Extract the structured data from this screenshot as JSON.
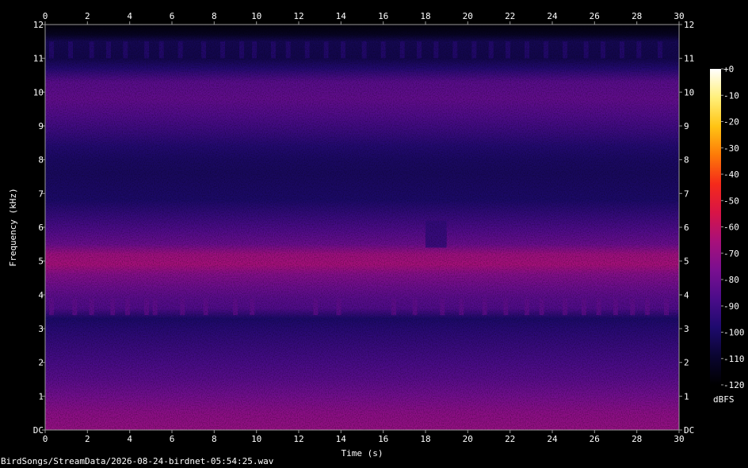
{
  "file": {
    "name": "BirdSongs/StreamData/2026-08-24-birdnet-05:54:25.wav"
  },
  "chart_data": {
    "type": "heatmap",
    "xlabel": "Time (s)",
    "ylabel": "Frequency (kHz)",
    "xlim": [
      0,
      30
    ],
    "ylim": [
      0,
      12
    ],
    "x_ticks": [
      0,
      2,
      4,
      6,
      8,
      10,
      12,
      14,
      16,
      18,
      20,
      22,
      24,
      26,
      28,
      30
    ],
    "y_ticks": [
      {
        "value": 0,
        "label": "DC"
      },
      {
        "value": 1,
        "label": "1"
      },
      {
        "value": 2,
        "label": "2"
      },
      {
        "value": 3,
        "label": "3"
      },
      {
        "value": 4,
        "label": "4"
      },
      {
        "value": 5,
        "label": "5"
      },
      {
        "value": 6,
        "label": "6"
      },
      {
        "value": 7,
        "label": "7"
      },
      {
        "value": 8,
        "label": "8"
      },
      {
        "value": 9,
        "label": "9"
      },
      {
        "value": 10,
        "label": "10"
      },
      {
        "value": 11,
        "label": "11"
      },
      {
        "value": 12,
        "label": "12"
      }
    ],
    "colorbar": {
      "label": "dBFS",
      "range": [
        -120,
        0
      ],
      "ticks": [
        {
          "value": 0,
          "label": "+0"
        },
        {
          "value": -10,
          "label": "-10"
        },
        {
          "value": -20,
          "label": "-20"
        },
        {
          "value": -30,
          "label": "-30"
        },
        {
          "value": -40,
          "label": "-40"
        },
        {
          "value": -50,
          "label": "-50"
        },
        {
          "value": -60,
          "label": "-60"
        },
        {
          "value": -70,
          "label": "-70"
        },
        {
          "value": -80,
          "label": "-80"
        },
        {
          "value": -90,
          "label": "-90"
        },
        {
          "value": -100,
          "label": "-100"
        },
        {
          "value": -110,
          "label": "-110"
        },
        {
          "value": -120,
          "label": "-120"
        }
      ],
      "colors": [
        "#000000",
        "#0a0530",
        "#1e0a6e",
        "#4b0c8a",
        "#7a0f90",
        "#a8107a",
        "#d81446",
        "#f52a1a",
        "#fd7a08",
        "#ffc414",
        "#fff07a",
        "#ffffff"
      ]
    },
    "frequency_profile_dbfs": [
      {
        "khz": 0.0,
        "db": -70
      },
      {
        "khz": 0.5,
        "db": -72
      },
      {
        "khz": 1.0,
        "db": -78
      },
      {
        "khz": 1.5,
        "db": -84
      },
      {
        "khz": 2.0,
        "db": -88
      },
      {
        "khz": 2.5,
        "db": -92
      },
      {
        "khz": 3.0,
        "db": -96
      },
      {
        "khz": 3.3,
        "db": -99
      },
      {
        "khz": 3.6,
        "db": -86
      },
      {
        "khz": 3.9,
        "db": -84
      },
      {
        "khz": 4.2,
        "db": -80
      },
      {
        "khz": 4.6,
        "db": -74
      },
      {
        "khz": 4.9,
        "db": -66
      },
      {
        "khz": 5.2,
        "db": -68
      },
      {
        "khz": 5.5,
        "db": -80
      },
      {
        "khz": 5.9,
        "db": -86
      },
      {
        "khz": 6.3,
        "db": -92
      },
      {
        "khz": 6.8,
        "db": -99
      },
      {
        "khz": 7.2,
        "db": -100
      },
      {
        "khz": 7.6,
        "db": -101
      },
      {
        "khz": 8.0,
        "db": -100
      },
      {
        "khz": 8.4,
        "db": -97
      },
      {
        "khz": 8.8,
        "db": -92
      },
      {
        "khz": 9.3,
        "db": -86
      },
      {
        "khz": 9.8,
        "db": -82
      },
      {
        "khz": 10.3,
        "db": -84
      },
      {
        "khz": 10.7,
        "db": -97
      },
      {
        "khz": 11.0,
        "db": -104
      },
      {
        "khz": 11.5,
        "db": -103
      },
      {
        "khz": 11.7,
        "db": -112
      },
      {
        "khz": 12.0,
        "db": -118
      }
    ],
    "events": [
      {
        "label": "chirps ~3.6 kHz",
        "khz_low": 3.4,
        "khz_high": 3.9,
        "db": -82,
        "times_s": [
          0.3,
          1.4,
          2.2,
          3.2,
          3.9,
          4.8,
          5.2,
          6.5,
          7.6,
          9.0,
          9.8,
          12.8,
          13.9,
          16.5,
          17.5,
          18.8,
          19.7,
          20.8,
          21.8,
          22.8,
          23.5,
          24.6,
          25.5,
          26.2,
          27.0,
          27.8,
          28.5,
          29.4
        ]
      },
      {
        "label": "chirps ~11.2 kHz",
        "khz_low": 11.0,
        "khz_high": 11.5,
        "db": -96,
        "times_s": [
          0.3,
          1.2,
          2.2,
          3.0,
          3.8,
          4.8,
          5.5,
          6.4,
          7.5,
          8.4,
          9.3,
          9.9,
          10.8,
          11.5,
          12.4,
          13.3,
          14.1,
          15.1,
          16.0,
          16.9,
          17.7,
          18.5,
          19.4,
          20.3,
          21.1,
          21.9,
          22.8,
          23.7,
          24.6,
          25.6,
          26.4,
          27.3,
          28.1,
          29.1
        ]
      },
      {
        "label": "broadband patch",
        "khz_low": 5.4,
        "khz_high": 6.2,
        "t_start": 18.0,
        "t_end": 19.0,
        "db": -94
      }
    ]
  }
}
